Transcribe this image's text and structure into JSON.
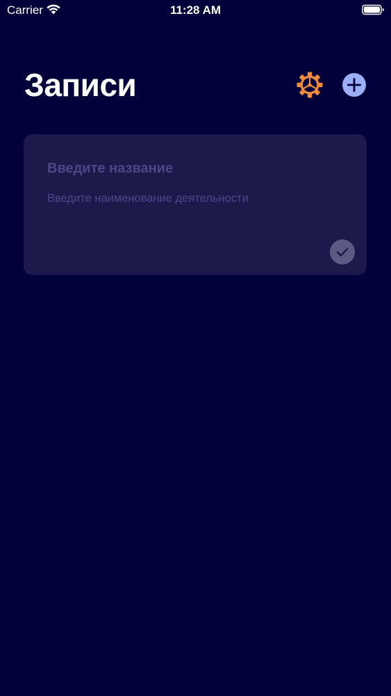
{
  "status_bar": {
    "carrier": "Carrier",
    "time": "11:28 AM"
  },
  "header": {
    "title": "Записи"
  },
  "icons": {
    "settings": "gear-icon",
    "add": "plus-circle-icon",
    "check": "checkmark-icon"
  },
  "colors": {
    "background": "#02013a",
    "card": "#1d1a4b",
    "placeholder_text": "#4b4887",
    "settings_accent": "#f08a3c",
    "add_accent": "#9aaef5"
  },
  "entries": [
    {
      "title_placeholder": "Введите название",
      "subtitle_placeholder": "Введите наименование деятельности"
    }
  ]
}
